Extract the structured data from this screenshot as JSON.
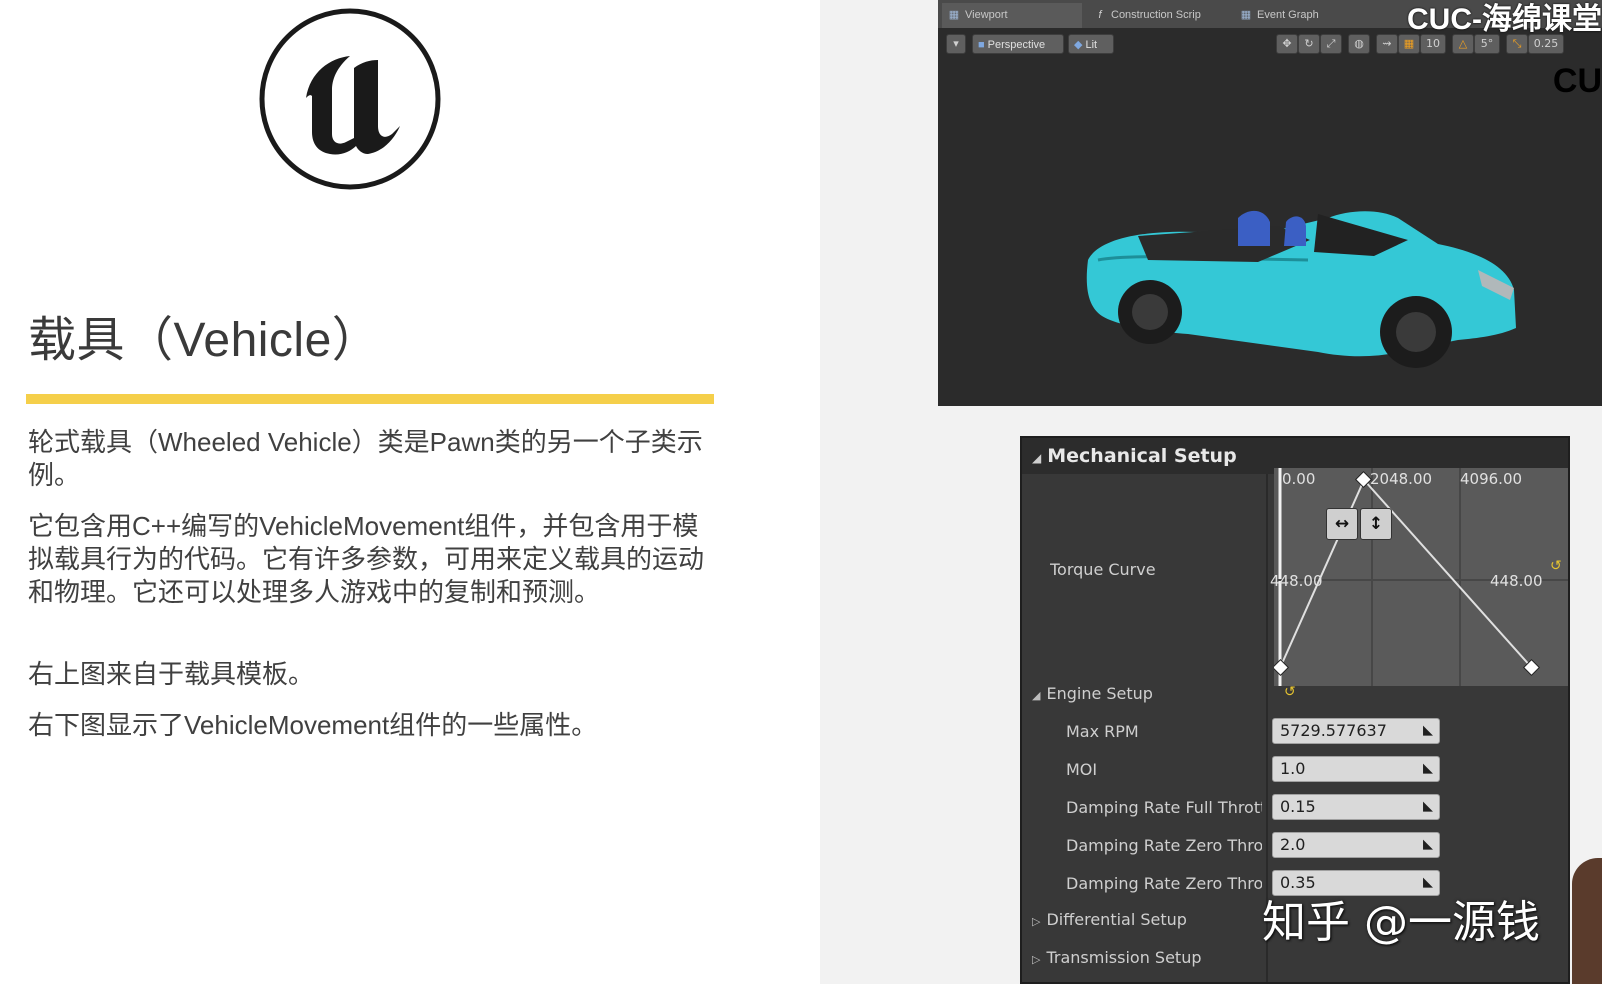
{
  "slide": {
    "title": "载具（Vehicle）",
    "paragraphs": [
      "轮式载具（Wheeled Vehicle）类是Pawn类的另一个子类示例。",
      "它包含用C++编写的VehicleMovement组件，并包含用于模拟载具行为的代码。它有许多参数，可用来定义载具的运动和物理。它还可以处理多人游戏中的复制和预测。",
      "右上图来自于载具模板。",
      "右下图显示了VehicleMovement组件的一些属性。"
    ],
    "accent_color": "#f5cf4a"
  },
  "viewport": {
    "tabs": [
      "Viewport",
      "Construction Scrip",
      "Event Graph"
    ],
    "watermark": "CUC-海绵课堂",
    "corner_mark": "CU",
    "toolbar": {
      "perspective": "Perspective",
      "lit": "Lit",
      "grid_value": "10",
      "rotation_value": "5°",
      "scale_value": "0.25"
    },
    "car_color": "#33c9d6"
  },
  "panel": {
    "header": "Mechanical Setup",
    "torque_curve": {
      "label": "Torque Curve",
      "x_labels": [
        "0.00",
        "2048.00",
        "4096.00"
      ],
      "y_labels_left": "448.00",
      "y_labels_right": "448.00"
    },
    "engine_setup": {
      "label": "Engine Setup",
      "properties": [
        {
          "label": "Max RPM",
          "value": "5729.577637"
        },
        {
          "label": "MOI",
          "value": "1.0"
        },
        {
          "label": "Damping Rate Full Thrott",
          "value": "0.15"
        },
        {
          "label": "Damping Rate Zero Throt",
          "value": "2.0"
        },
        {
          "label": "Damping Rate Zero Thro",
          "value": "0.35"
        }
      ]
    },
    "categories": [
      "Differential Setup",
      "Transmission Setup"
    ]
  },
  "overlay_watermark": "知乎 @一源钱"
}
